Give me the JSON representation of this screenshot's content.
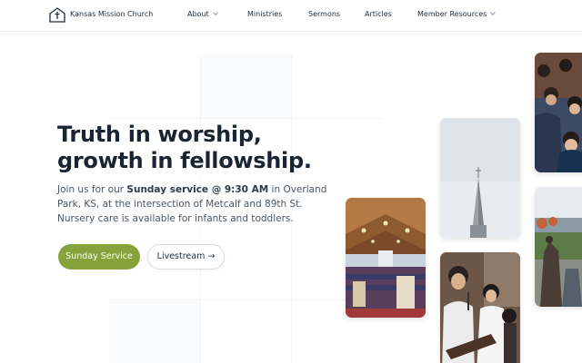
{
  "header": {
    "brand": "Kansas Mission Church",
    "nav": [
      {
        "label": "About"
      },
      {
        "label": "Ministries"
      },
      {
        "label": "Sermons"
      },
      {
        "label": "Articles"
      },
      {
        "label": "Member Resources"
      }
    ]
  },
  "hero": {
    "headline": "Truth in worship, growth in fellowship.",
    "lead_part1": "Join us for our ",
    "lead_bold": "Sunday service @ 9:30 AM",
    "lead_part2": " in Overland Park, KS, at the intersection of Metcalf and 89th St. Nursery care is available for infants and toddlers.",
    "primary_button": "Sunday Service",
    "secondary_button": "Livestream →"
  },
  "colors": {
    "accent": "#86a23a",
    "text_dark": "#1a2533",
    "text_body": "#4a5561"
  },
  "icons": {
    "logo": "church-cross-icon",
    "dropdown": "chevron-down-icon"
  }
}
